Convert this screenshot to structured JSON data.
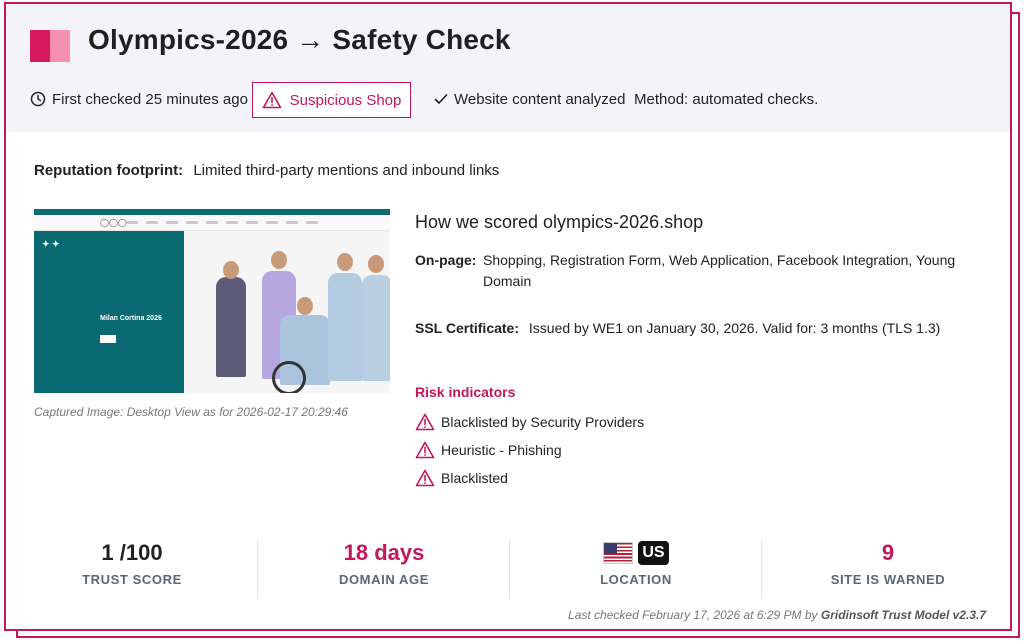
{
  "header": {
    "title": "Olympics-2026 → Safety Check",
    "first_checked": "First checked 25 minutes ago",
    "badge_label": "Suspicious Shop",
    "analyzed": "Website content analyzed",
    "method": "Method: automated checks."
  },
  "reputation": {
    "label": "Reputation footprint:",
    "value": "Limited third-party mentions and inbound links"
  },
  "screenshot": {
    "banner_text": "Milan Cortina 2026",
    "caption": "Captured Image: Desktop View as for 2026-02-17 20:29:46"
  },
  "scoring": {
    "title": "How we scored olympics-2026.shop",
    "onpage_label": "On-page:",
    "onpage_value": "Shopping, Registration Form, Web Application, Facebook Integration, Young Domain",
    "ssl_label": "SSL Certificate:",
    "ssl_value": "Issued by WE1 on January 30, 2026. Valid for: 3 months (TLS 1.3)"
  },
  "risk": {
    "title": "Risk indicators",
    "items": [
      "Blacklisted by Security Providers",
      "Heuristic - Phishing",
      "Blacklisted"
    ]
  },
  "stats": {
    "trust_score": "1 /100",
    "trust_label": "TRUST SCORE",
    "domain_age": "18 days",
    "domain_label": "DOMAIN AGE",
    "location_code": "US",
    "location_label": "LOCATION",
    "warned": "9",
    "warned_label": "SITE IS WARNED"
  },
  "footer": {
    "prefix": "Last checked February 17, 2026 at 6:29 PM by",
    "model": "Gridinsoft Trust Model v2.3.7"
  },
  "colors": {
    "accent": "#c2185b",
    "header_bg": "#f3f3f9",
    "label_gray": "#596879"
  },
  "icons": [
    "clock-icon",
    "warning-triangle-icon",
    "check-icon",
    "us-flag-icon"
  ]
}
